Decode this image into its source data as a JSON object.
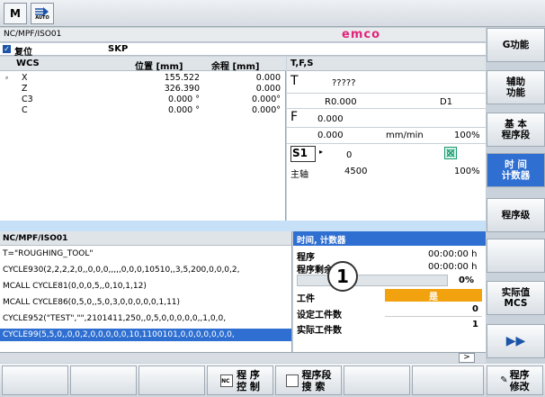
{
  "topbar": {
    "icon1": "M",
    "icon2_label": "AUTO"
  },
  "header": {
    "path": "NC/MPF/ISO01",
    "logo": "emco"
  },
  "status": {
    "reset": "复位",
    "skp": "SKP"
  },
  "wcs": {
    "columns": [
      "WCS",
      "位置 [mm]",
      "余程 [mm]"
    ],
    "rows": [
      {
        "axis": "X",
        "pos": "155.522",
        "rest": "0.000"
      },
      {
        "axis": "Z",
        "pos": "326.390",
        "rest": "0.000"
      },
      {
        "axis": "C3",
        "pos": "0.000 °",
        "rest": "0.000°"
      },
      {
        "axis": "C",
        "pos": "0.000 °",
        "rest": "0.000°"
      }
    ]
  },
  "tfs": {
    "title": "T,F,S",
    "t_label": "T",
    "t_value": "?????",
    "r_value": "R0.000",
    "d_value": "D1",
    "f_label": "F",
    "f_value": "0.000",
    "f_value2": "0.000",
    "f_unit": "mm/min",
    "f_pct": "100%",
    "s_label": "S1",
    "s_value": "0",
    "spindle_label": "主轴",
    "spindle_value": "4500",
    "spindle_pct": "100%"
  },
  "program": {
    "title": "NC/MPF/ISO01",
    "lines": [
      "T=\"ROUGHING_TOOL\"",
      "CYCLE930(2,2,2,2,0,,0,0,0,,,,,0,0,0,10510,,3,5,200,0,0,0,2,",
      "MCALL CYCLE81(0,0,0,5,,0,10,1,12)",
      "MCALL CYCLE86(0,5,0,,5,0,3,0,0,0,0,0,1,11)",
      "CYCLE952(\"TEST\",\"\",2101411,250,,0,5,0,0,0,0,0,,1,0,0,",
      "CYCLE99(5,5,0,,0,0,2,0,0,0,0,0,10,1100101,0,0,0,0,0,0,0,"
    ]
  },
  "timer": {
    "title": "时间, 计数器",
    "program_label": "程序",
    "program_value": "00:00:00 h",
    "remaining_label": "程序剩余时间",
    "remaining_value": "00:00:00 h",
    "progress_pct": "0%",
    "workpiece_label": "工件",
    "workpiece_value": "是",
    "set_label": "设定工件数",
    "set_value": "0",
    "actual_label": "实际工件数",
    "actual_value": "1",
    "callout": "1"
  },
  "right_softkeys": [
    {
      "label": "G功能"
    },
    {
      "label": "辅助\n功能"
    },
    {
      "label": "基 本\n程序段"
    },
    {
      "label": "时 间\n计数器"
    },
    {
      "label": "程序级"
    },
    {
      "label": ""
    },
    {
      "label": "实际值\nMCS"
    },
    {
      "label": "▶▶"
    },
    {
      "label": "程序\n修改"
    }
  ],
  "bottom_softkeys": {
    "prog_control": "程 序\n控 制",
    "prog_search": "程序段\n搜 索",
    "scroll_arrow": ">"
  }
}
